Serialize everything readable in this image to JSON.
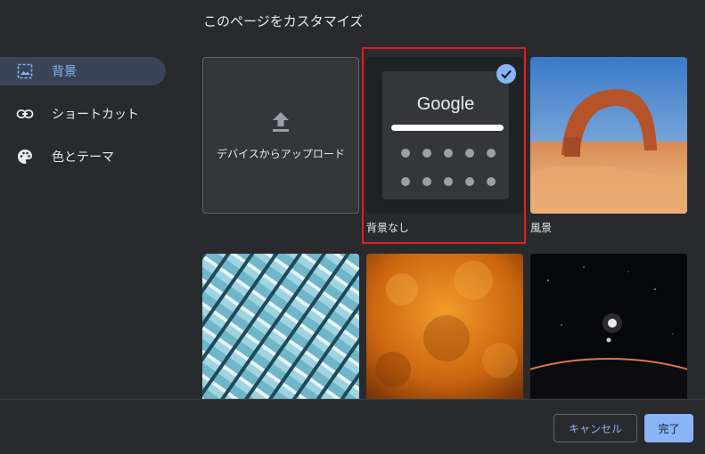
{
  "dialog": {
    "title": "このページをカスタマイズ"
  },
  "sidebar": {
    "items": [
      {
        "label": "背景",
        "icon": "image-icon",
        "active": true
      },
      {
        "label": "ショートカット",
        "icon": "link-icon",
        "active": false
      },
      {
        "label": "色とテーマ",
        "icon": "palette-icon",
        "active": false
      }
    ]
  },
  "tiles": {
    "upload": {
      "label": "デバイスからアップロード",
      "icon": "upload-icon"
    },
    "no_background": {
      "caption": "背景なし",
      "logo_text": "Google",
      "selected": true
    },
    "landscape": {
      "caption": "風景"
    }
  },
  "footer": {
    "cancel_label": "キャンセル",
    "done_label": "完了"
  },
  "colors": {
    "accent": "#8ab4f8",
    "background": "#292a2d",
    "highlight": "#e51c23"
  }
}
